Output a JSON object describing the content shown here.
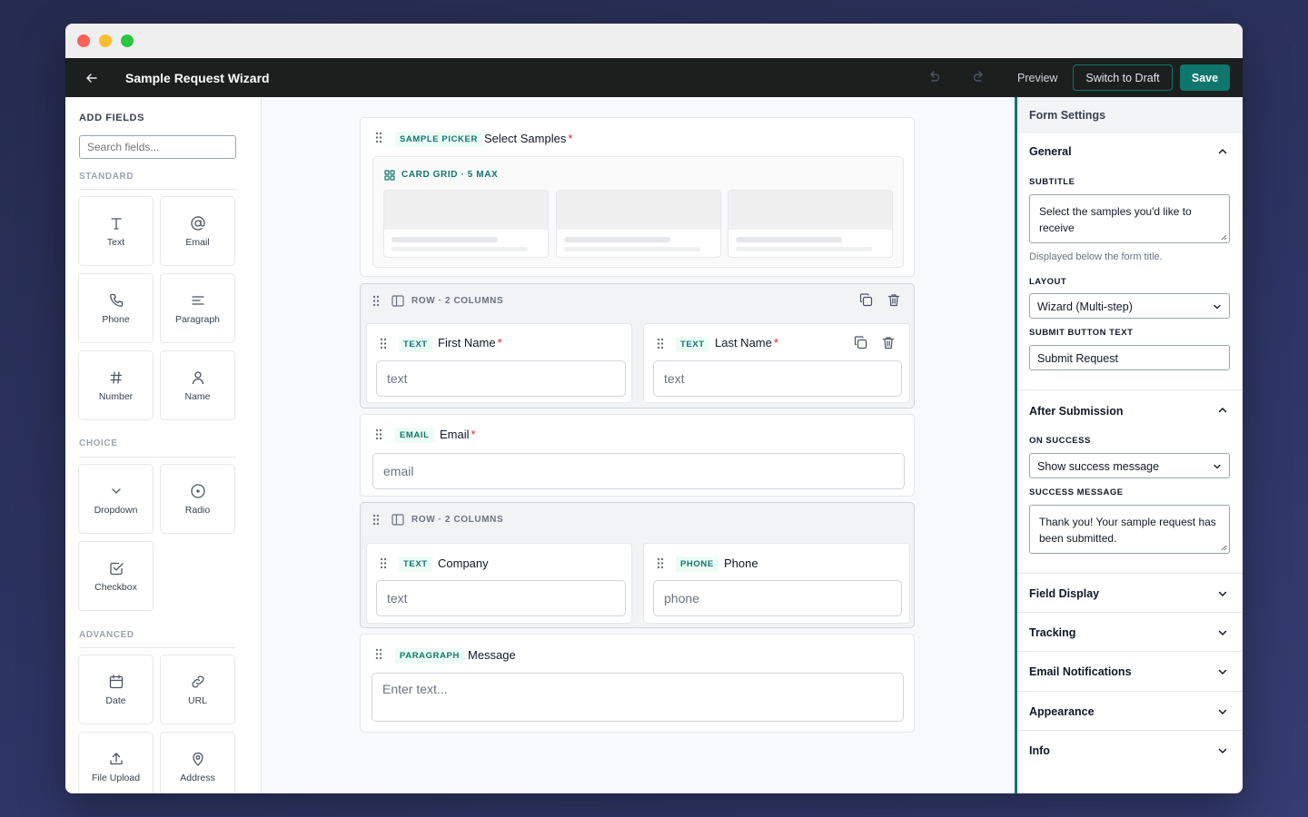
{
  "window": {
    "traffic_lights": [
      "close",
      "minimize",
      "maximize"
    ]
  },
  "topbar": {
    "title": "Sample Request Wizard",
    "preview_label": "Preview",
    "draft_label": "Switch to Draft",
    "save_label": "Save"
  },
  "left_sidebar": {
    "title": "ADD FIELDS",
    "search_placeholder": "Search fields...",
    "sections": {
      "standard": {
        "label": "STANDARD",
        "items": [
          "Text",
          "Email",
          "Phone",
          "Paragraph",
          "Number",
          "Name"
        ]
      },
      "choice": {
        "label": "CHOICE",
        "items": [
          "Dropdown",
          "Radio",
          "Checkbox"
        ]
      },
      "advanced": {
        "label": "ADVANCED",
        "items": [
          "Date",
          "URL",
          "File Upload",
          "Address"
        ]
      }
    }
  },
  "canvas": {
    "sample_picker": {
      "tag": "SAMPLE PICKER",
      "title": "Select Samples",
      "required": "*",
      "grid_label": "CARD GRID · 5 MAX",
      "placeholder_cards": 3
    },
    "row1": {
      "label": "ROW · 2 COLUMNS",
      "left": {
        "tag": "TEXT",
        "title": "First Name",
        "required": "*",
        "input": "text"
      },
      "right": {
        "tag": "TEXT",
        "title": "Last Name",
        "required": "*",
        "input": "text"
      }
    },
    "email": {
      "tag": "EMAIL",
      "title": "Email",
      "required": "*",
      "input": "email"
    },
    "row2": {
      "label": "ROW · 2 COLUMNS",
      "left": {
        "tag": "TEXT",
        "title": "Company",
        "input": "text"
      },
      "right": {
        "tag": "PHONE",
        "title": "Phone",
        "input": "phone"
      }
    },
    "message": {
      "tag": "PARAGRAPH",
      "title": "Message",
      "input": "Enter text..."
    }
  },
  "right_sidebar": {
    "title": "Form Settings",
    "general": {
      "title": "General",
      "subtitle_label": "SUBTITLE",
      "subtitle_value": "Select the samples you'd like to receive",
      "subtitle_help": "Displayed below the form title.",
      "layout_label": "LAYOUT",
      "layout_value": "Wizard (Multi-step)",
      "submit_label": "SUBMIT BUTTON TEXT",
      "submit_value": "Submit Request"
    },
    "after_submission": {
      "title": "After Submission",
      "on_success_label": "ON SUCCESS",
      "on_success_value": "Show success message",
      "success_message_label": "SUCCESS MESSAGE",
      "success_message_value": "Thank you! Your sample request has been submitted."
    },
    "collapsed": [
      "Field Display",
      "Tracking",
      "Email Notifications",
      "Appearance",
      "Info"
    ]
  },
  "colors": {
    "accent": "#0f766e",
    "topbar": "#1b1f1e",
    "required": "#dc2626",
    "background": "#2d3462"
  }
}
